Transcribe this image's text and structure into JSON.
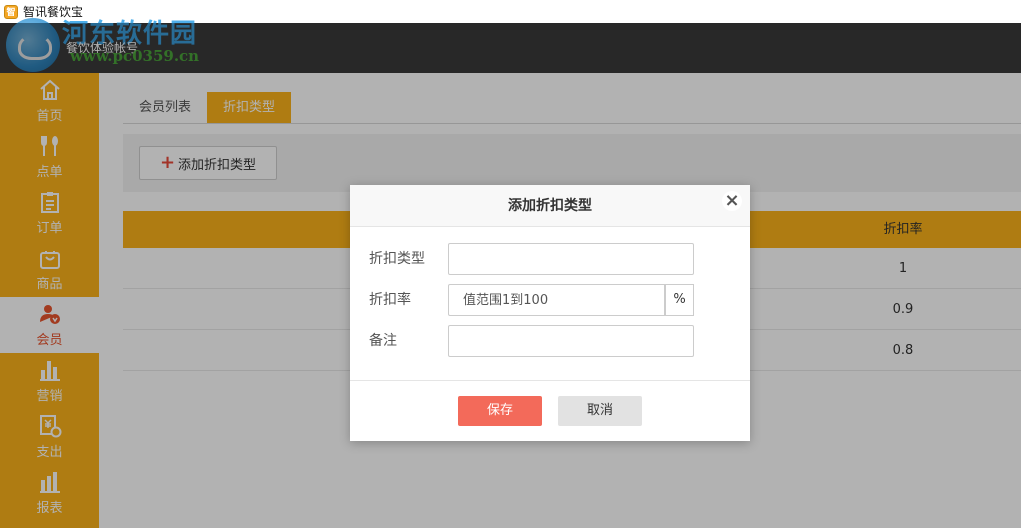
{
  "app": {
    "title": "智讯餐饮宝",
    "account": "餐饮体验帐号",
    "watermark": "河东软件园",
    "watermark_url": "www.pc0359.cn"
  },
  "sidebar": {
    "items": [
      {
        "label": "首页",
        "icon": "home-icon"
      },
      {
        "label": "点单",
        "icon": "cutlery-icon"
      },
      {
        "label": "订单",
        "icon": "clipboard-icon"
      },
      {
        "label": "商品",
        "icon": "bag-icon"
      },
      {
        "label": "会员",
        "icon": "member-icon",
        "active": true
      },
      {
        "label": "营销",
        "icon": "bar-chart-icon"
      },
      {
        "label": "支出",
        "icon": "expense-icon"
      },
      {
        "label": "报表",
        "icon": "report-icon"
      }
    ]
  },
  "tabs": [
    {
      "label": "会员列表",
      "active": false
    },
    {
      "label": "折扣类型",
      "active": true
    }
  ],
  "toolbar": {
    "add_label": "添加折扣类型"
  },
  "table": {
    "columns": [
      "折扣率"
    ],
    "rows": [
      {
        "rate": "1"
      },
      {
        "rate": "0.9"
      },
      {
        "rate": "0.8"
      }
    ]
  },
  "dialog": {
    "title": "添加折扣类型",
    "close": "×",
    "fields": {
      "type_label": "折扣类型",
      "type_value": "",
      "rate_label": "折扣率",
      "rate_placeholder": "值范围1到100",
      "rate_suffix": "%",
      "note_label": "备注",
      "note_value": ""
    },
    "save_label": "保存",
    "cancel_label": "取消"
  },
  "colors": {
    "accent": "#fbb21a",
    "header": "#3a3a3a",
    "active_text": "#e8552e",
    "save": "#f36a5a"
  }
}
